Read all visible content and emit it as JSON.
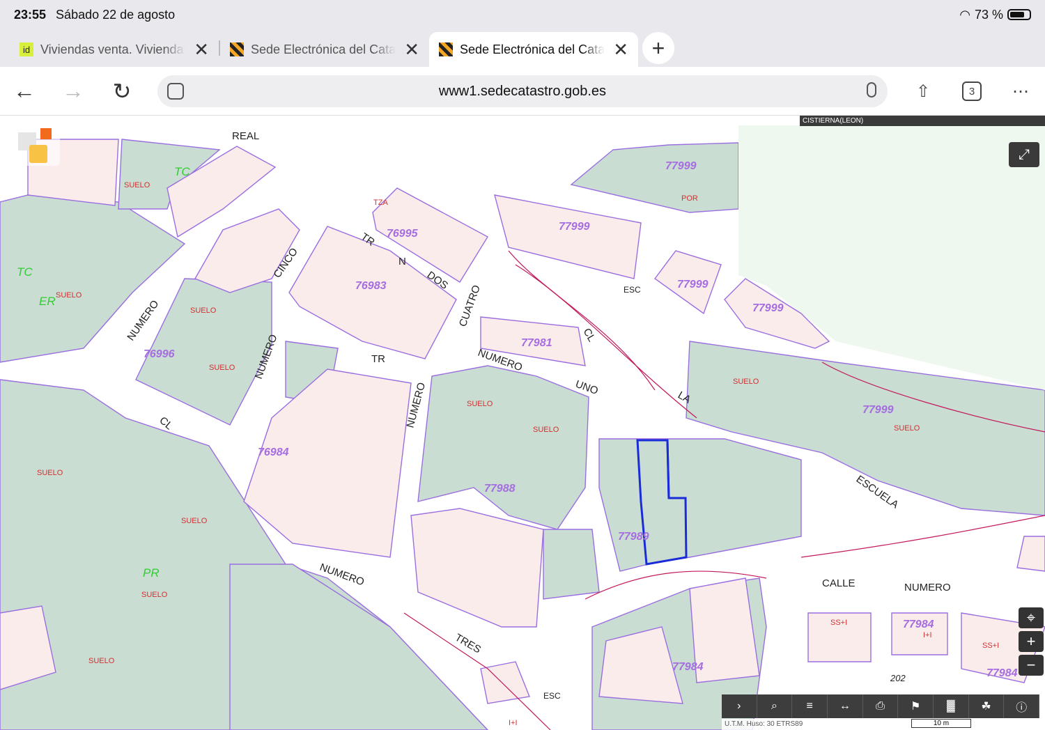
{
  "status": {
    "time": "23:55",
    "date": "Sábado 22 de agosto",
    "battery": "73 %"
  },
  "tabs": [
    {
      "title": "Viviendas venta. Viviendas",
      "favicon": "id"
    },
    {
      "title": "Sede Electrónica del Catastro",
      "favicon": ""
    },
    {
      "title": "Sede Electrónica del Catastro",
      "favicon": ""
    }
  ],
  "toolbar": {
    "url": "www1.sedecatastro.gob.es",
    "tab_count": "3"
  },
  "map": {
    "municipality": "CISTIERNA(LEON)",
    "coord_text": "U.T.M. Huso: 30 ETRS89",
    "scale": "10 m",
    "labels": {
      "ref_77999": "77999",
      "ref_76995": "76995",
      "ref_76983": "76983",
      "ref_76996": "76996",
      "ref_76984": "76984",
      "ref_77988": "77988",
      "ref_77989": "77989",
      "ref_77984": "77984",
      "ref_77981": "77981",
      "real": "REAL",
      "cinco": "CINCO",
      "numero": "NUMERO",
      "cuatro": "CUATRO",
      "dos": "DOS",
      "escuela": "ESCUELA",
      "calle": "CALLE",
      "tres": "TRES",
      "uno": "UNO",
      "suelo": "SUELO",
      "pr": "PR",
      "tc": "TC",
      "er": "ER",
      "cl": "CL",
      "la": "LA",
      "tr": "TR",
      "n": "N",
      "esc": "ESC",
      "por": "POR",
      "tza": "TZA",
      "ss_i": "SS+I",
      "i_i": "I+I",
      "n202": "202"
    }
  }
}
